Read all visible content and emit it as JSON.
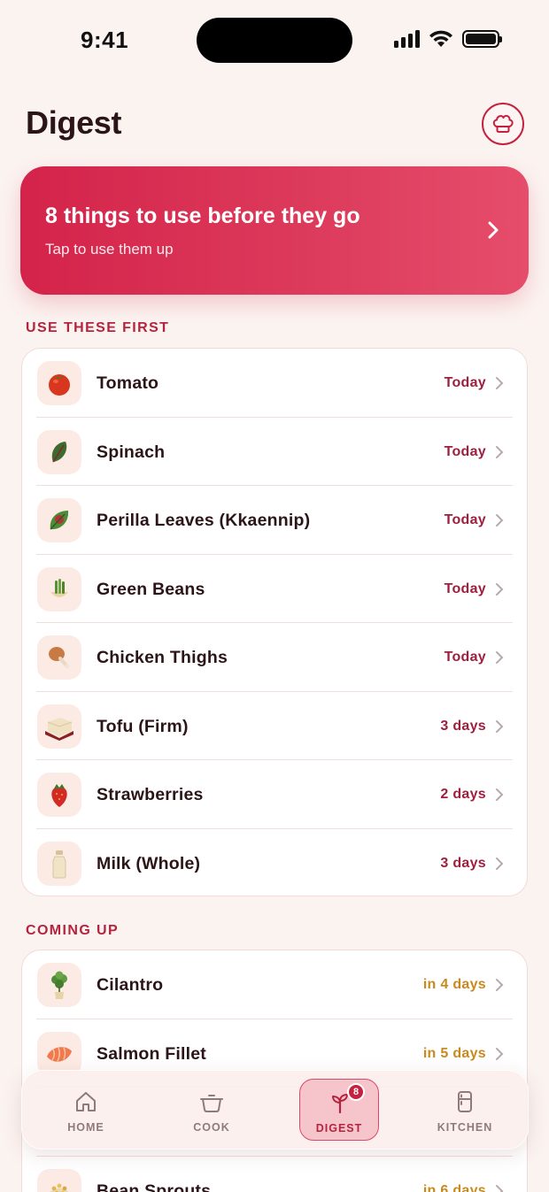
{
  "status_bar": {
    "time": "9:41"
  },
  "header": {
    "title": "Digest",
    "chef_icon": "chef-hat-icon"
  },
  "banner": {
    "title": "8 things to use before they go",
    "subtitle": "Tap to use them up"
  },
  "use_first": {
    "heading": "USE THESE FIRST",
    "items": [
      {
        "name": "Tomato",
        "when": "Today",
        "icon": "tomato-icon"
      },
      {
        "name": "Spinach",
        "when": "Today",
        "icon": "spinach-icon"
      },
      {
        "name": "Perilla Leaves (Kkaennip)",
        "when": "Today",
        "icon": "perilla-leaf-icon"
      },
      {
        "name": "Green Beans",
        "when": "Today",
        "icon": "green-beans-icon"
      },
      {
        "name": "Chicken Thighs",
        "when": "Today",
        "icon": "chicken-leg-icon"
      },
      {
        "name": "Tofu (Firm)",
        "when": "3 days",
        "icon": "tofu-icon"
      },
      {
        "name": "Strawberries",
        "when": "2 days",
        "icon": "strawberry-icon"
      },
      {
        "name": "Milk (Whole)",
        "when": "3 days",
        "icon": "milk-bottle-icon"
      }
    ]
  },
  "coming_up": {
    "heading": "COMING UP",
    "items": [
      {
        "name": "Cilantro",
        "when": "in 4 days",
        "icon": "cilantro-icon"
      },
      {
        "name": "Salmon Fillet",
        "when": "in 5 days",
        "icon": "salmon-icon"
      },
      {
        "name": "",
        "when": "",
        "icon": ""
      },
      {
        "name": "Bean Sprouts",
        "when": "in 6 days",
        "icon": "bean-sprouts-icon"
      }
    ]
  },
  "tabbar": {
    "tabs": [
      {
        "label": "HOME",
        "icon": "home-icon"
      },
      {
        "label": "COOK",
        "icon": "pot-icon"
      },
      {
        "label": "DIGEST",
        "icon": "sprout-icon",
        "badge": "8",
        "active": true
      },
      {
        "label": "KITCHEN",
        "icon": "fridge-icon"
      }
    ]
  },
  "colors": {
    "accent": "#c6203f",
    "banner_start": "#d4234a",
    "banner_end": "#e64d6b",
    "urgent_text": "#9e1f3e",
    "soon_text": "#c98a1d",
    "background": "#fbf3f0"
  }
}
